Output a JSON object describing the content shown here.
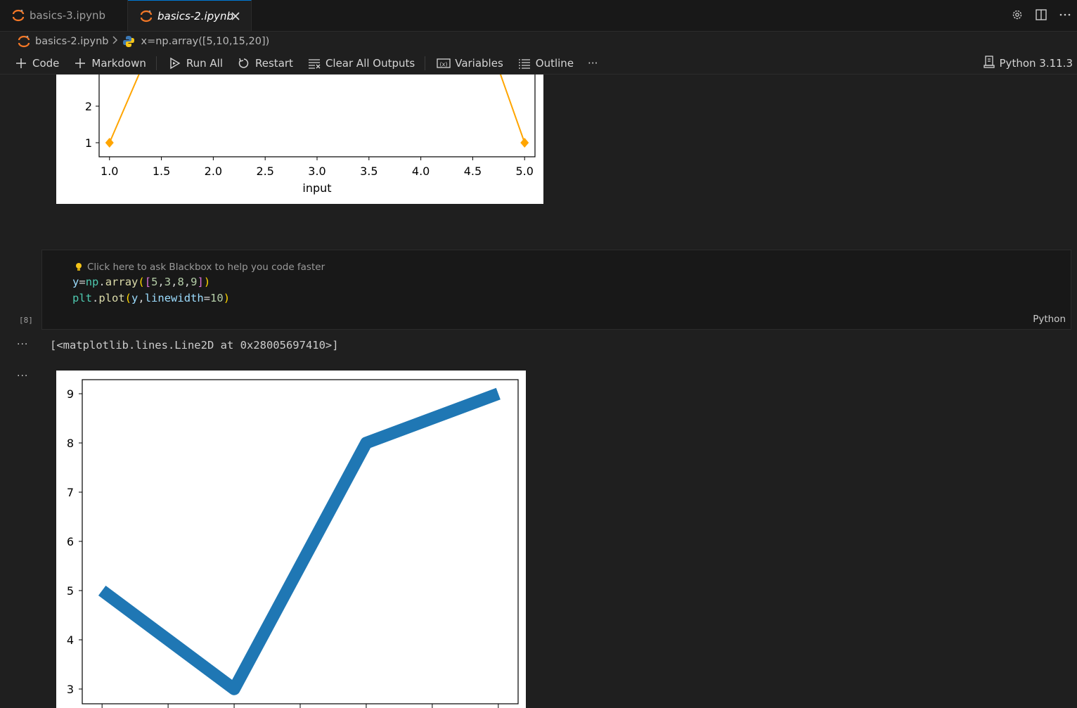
{
  "tabs": [
    {
      "label": "basics-3.ipynb",
      "active": false
    },
    {
      "label": "basics-2.ipynb",
      "active": true
    }
  ],
  "tab_actions": [
    "settings-gear-icon",
    "split-editor-icon",
    "more-actions-icon"
  ],
  "breadcrumb": {
    "file": "basics-2.ipynb",
    "symbol": "x=np.array([5,10,15,20])"
  },
  "toolbar": {
    "code": "Code",
    "markdown": "Markdown",
    "run_all": "Run All",
    "restart": "Restart",
    "clear_all": "Clear All Outputs",
    "variables": "Variables",
    "outline": "Outline",
    "more": "···",
    "kernel": "Python 3.11.3"
  },
  "cell": {
    "hint": "Click here to ask Blackbox to help you code faster",
    "execution_count": "[8]",
    "language": "Python",
    "code_lines": [
      "y=np.array([5,3,8,9])",
      "plt.plot(y,linewidth=10)"
    ]
  },
  "text_output": "[<matplotlib.lines.Line2D at 0x28005697410>]",
  "output_menu": "···",
  "chart_data": [
    {
      "type": "line",
      "partially_visible": true,
      "xlabel": "input",
      "x_ticks": [
        "1.0",
        "1.5",
        "2.0",
        "2.5",
        "3.0",
        "3.5",
        "4.0",
        "4.5",
        "5.0"
      ],
      "y_ticks_visible": [
        "1",
        "2"
      ],
      "xlim": [
        0.9,
        5.1
      ],
      "color": "#ffa500",
      "marker": "diamond",
      "visible_points": [
        {
          "x": 1.0,
          "y": 1
        },
        {
          "x": 5.0,
          "y": 1
        }
      ]
    },
    {
      "type": "line",
      "partially_visible": true,
      "x": [
        0,
        1,
        2,
        3
      ],
      "y": [
        5,
        3,
        8,
        9
      ],
      "y_ticks": [
        "3",
        "4",
        "5",
        "6",
        "7",
        "8",
        "9"
      ],
      "xlim": [
        -0.15,
        3.15
      ],
      "ylim": [
        2.7,
        9.3
      ],
      "color": "#1f77b4",
      "linewidth": 10
    }
  ]
}
